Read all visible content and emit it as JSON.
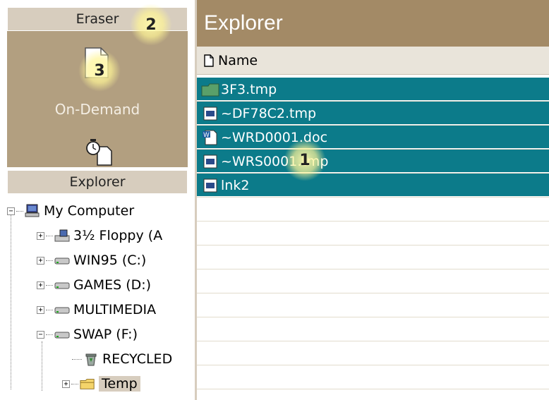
{
  "sidebar": {
    "eraser_header": "Eraser",
    "on_demand_label": "On-Demand",
    "explorer_header": "Explorer",
    "tree": [
      {
        "label": "My Computer",
        "icon": "computer-icon"
      },
      {
        "label": "3½ Floppy (A",
        "icon": "floppy-drive-icon"
      },
      {
        "label": "WIN95 (C:)",
        "icon": "hard-drive-icon"
      },
      {
        "label": "GAMES (D:)",
        "icon": "hard-drive-icon"
      },
      {
        "label": "MULTIMEDIA",
        "icon": "hard-drive-icon"
      },
      {
        "label": "SWAP (F:)",
        "icon": "hard-drive-icon"
      },
      {
        "label": "RECYCLED",
        "icon": "recycle-bin-icon"
      },
      {
        "label": "Temp",
        "icon": "folder-icon"
      }
    ]
  },
  "main": {
    "title": "Explorer",
    "column_name": "Name",
    "files": [
      {
        "name": "3F3.tmp",
        "icon": "folder-icon",
        "selected": true
      },
      {
        "name": "~DF78C2.tmp",
        "icon": "file-icon",
        "selected": true
      },
      {
        "name": "~WRD0001.doc",
        "icon": "word-doc-icon",
        "selected": true
      },
      {
        "name": "~WRS0001.tmp",
        "icon": "file-icon",
        "selected": true
      },
      {
        "name": "lnk2",
        "icon": "file-icon",
        "selected": true
      }
    ]
  },
  "callouts": [
    "1",
    "2",
    "3"
  ],
  "colors": {
    "selection": "#0c7b8a",
    "panel": "#b29f80",
    "title_bar": "#a38a66",
    "header": "#d7cdbe"
  }
}
